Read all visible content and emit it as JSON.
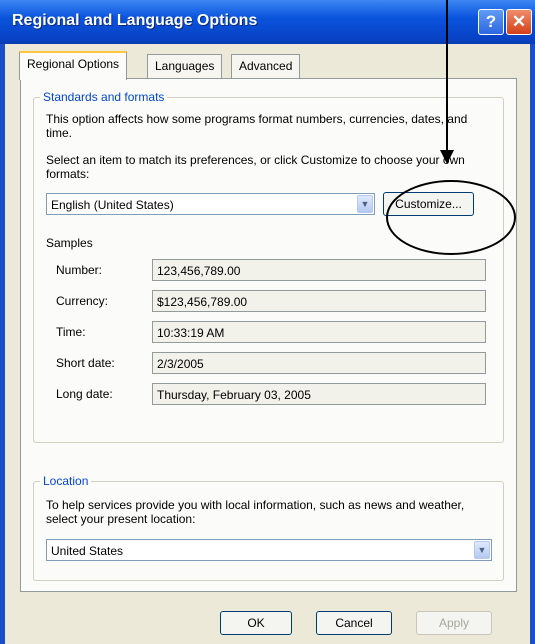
{
  "window": {
    "title": "Regional and Language Options"
  },
  "titlebar": {
    "help_glyph": "?",
    "close_glyph": "✕"
  },
  "tabs": [
    {
      "label": "Regional Options",
      "active": true
    },
    {
      "label": "Languages",
      "active": false
    },
    {
      "label": "Advanced",
      "active": false
    }
  ],
  "standards": {
    "legend": "Standards and formats",
    "description": "This option affects how some programs format numbers, currencies, dates, and time.",
    "select_prompt": "Select an item to match its preferences, or click Customize to choose your own formats:",
    "selected_locale": "English (United States)",
    "customize_label": "Customize...",
    "samples_heading": "Samples",
    "samples": [
      {
        "label": "Number:",
        "value": "123,456,789.00"
      },
      {
        "label": "Currency:",
        "value": "$123,456,789.00"
      },
      {
        "label": "Time:",
        "value": "10:33:19 AM"
      },
      {
        "label": "Short date:",
        "value": "2/3/2005"
      },
      {
        "label": "Long date:",
        "value": "Thursday, February 03, 2005"
      }
    ]
  },
  "location": {
    "legend": "Location",
    "description": "To help services provide you with local information, such as news and weather, select your present location:",
    "selected": "United States"
  },
  "buttons": {
    "ok": "OK",
    "cancel": "Cancel",
    "apply": "Apply"
  },
  "icons": {
    "dropdown": "▼"
  }
}
